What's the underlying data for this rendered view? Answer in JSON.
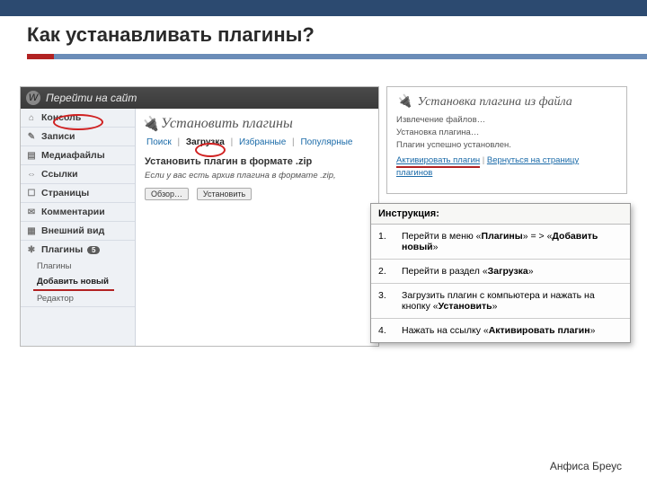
{
  "slide": {
    "title": "Как устанавливать плагины?",
    "author": "Анфиса Бреус"
  },
  "wp_admin": {
    "topbar": "Перейти на сайт",
    "menu": {
      "console": "Консоль",
      "posts": "Записи",
      "media": "Медиафайлы",
      "links": "Ссылки",
      "pages": "Страницы",
      "comments": "Комментарии",
      "appearance": "Внешний вид",
      "plugins": "Плагины",
      "plugins_badge": "5",
      "plugins_sub1": "Плагины",
      "plugins_sub2": "Добавить новый",
      "plugins_sub3": "Редактор"
    },
    "main": {
      "heading": "Установить плагины",
      "tabs": {
        "search": "Поиск",
        "upload": "Загрузка",
        "featured": "Избранные",
        "popular": "Популярные"
      },
      "section": "Установить плагин в формате .zip",
      "note": "Если у вас есть архив плагина в формате .zip,",
      "browse": "Обзор…",
      "install": "Установить"
    }
  },
  "install_result": {
    "heading": "Установка плагина из файла",
    "line1": "Извлечение файлов…",
    "line2": "Установка плагина…",
    "line3": "Плагин успешно установлен.",
    "link_activate": "Активировать плагин",
    "link_return": "Вернуться на страницу плагинов"
  },
  "instructions": {
    "title": "Инструкция:",
    "steps": [
      {
        "n": "1.",
        "text": "Перейти в меню «Плагины» = > «Добавить новый»"
      },
      {
        "n": "2.",
        "text": "Перейти в раздел «Загрузка»"
      },
      {
        "n": "3.",
        "text": "Загрузить плагин с компьютера и нажать на кнопку «Установить»"
      },
      {
        "n": "4.",
        "text": "Нажать на ссылку «Активировать плагин»"
      }
    ]
  }
}
